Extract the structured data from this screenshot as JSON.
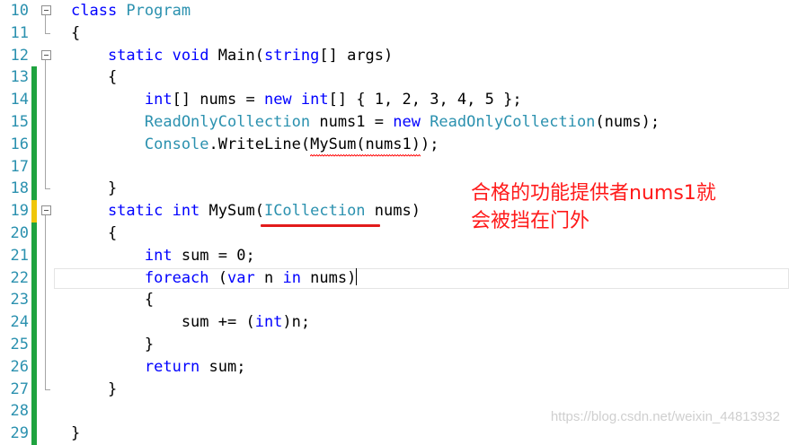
{
  "lines": [
    {
      "num": "10",
      "tokens": [
        {
          "t": "class ",
          "c": "kw"
        },
        {
          "t": "Program",
          "c": "ty"
        }
      ]
    },
    {
      "num": "11",
      "tokens": [
        {
          "t": "{",
          "c": ""
        }
      ]
    },
    {
      "num": "12",
      "tokens": [
        {
          "t": "    static void ",
          "c": "kw"
        },
        {
          "t": "Main(",
          "c": ""
        },
        {
          "t": "string",
          "c": "kw"
        },
        {
          "t": "[] args)",
          "c": ""
        }
      ]
    },
    {
      "num": "13",
      "tokens": [
        {
          "t": "    {",
          "c": ""
        }
      ]
    },
    {
      "num": "14",
      "tokens": [
        {
          "t": "        int",
          "c": "kw"
        },
        {
          "t": "[] nums = ",
          "c": ""
        },
        {
          "t": "new ",
          "c": "kw"
        },
        {
          "t": "int",
          "c": "kw"
        },
        {
          "t": "[] { 1, 2, 3, 4, 5 };",
          "c": ""
        }
      ]
    },
    {
      "num": "15",
      "tokens": [
        {
          "t": "        ReadOnlyCollection",
          "c": "ty"
        },
        {
          "t": " nums1 = ",
          "c": ""
        },
        {
          "t": "new ",
          "c": "kw"
        },
        {
          "t": "ReadOnlyCollection",
          "c": "ty"
        },
        {
          "t": "(nums);",
          "c": ""
        }
      ]
    },
    {
      "num": "16",
      "tokens": [
        {
          "t": "        Console",
          "c": "ty"
        },
        {
          "t": ".WriteLine(",
          "c": ""
        },
        {
          "t": "MySum(nums1)",
          "c": "sq"
        },
        {
          "t": ");",
          "c": ""
        }
      ]
    },
    {
      "num": "17",
      "tokens": []
    },
    {
      "num": "18",
      "tokens": [
        {
          "t": "    }",
          "c": ""
        }
      ]
    },
    {
      "num": "19",
      "tokens": [
        {
          "t": "    static int ",
          "c": "kw"
        },
        {
          "t": "MySum(",
          "c": ""
        },
        {
          "t": "ICollection",
          "c": "ty"
        },
        {
          "t": " nums)",
          "c": ""
        }
      ]
    },
    {
      "num": "20",
      "tokens": [
        {
          "t": "    {",
          "c": ""
        }
      ]
    },
    {
      "num": "21",
      "tokens": [
        {
          "t": "        int ",
          "c": "kw"
        },
        {
          "t": "sum = 0;",
          "c": ""
        }
      ]
    },
    {
      "num": "22",
      "tokens": [
        {
          "t": "        foreach ",
          "c": "kw"
        },
        {
          "t": "(",
          "c": ""
        },
        {
          "t": "var ",
          "c": "kw"
        },
        {
          "t": "n ",
          "c": ""
        },
        {
          "t": "in ",
          "c": "kw"
        },
        {
          "t": "nums)",
          "c": ""
        }
      ]
    },
    {
      "num": "23",
      "tokens": [
        {
          "t": "        {",
          "c": ""
        }
      ]
    },
    {
      "num": "24",
      "tokens": [
        {
          "t": "            sum += (",
          "c": ""
        },
        {
          "t": "int",
          "c": "kw"
        },
        {
          "t": ")n;",
          "c": ""
        }
      ]
    },
    {
      "num": "25",
      "tokens": [
        {
          "t": "        }",
          "c": ""
        }
      ]
    },
    {
      "num": "26",
      "tokens": [
        {
          "t": "        return ",
          "c": "kw"
        },
        {
          "t": "sum;",
          "c": ""
        }
      ]
    },
    {
      "num": "27",
      "tokens": [
        {
          "t": "    }",
          "c": ""
        }
      ]
    },
    {
      "num": "28",
      "tokens": []
    },
    {
      "num": "29",
      "tokens": [
        {
          "t": "}",
          "c": ""
        }
      ]
    }
  ],
  "changed_lines": [
    "13",
    "14",
    "15",
    "16",
    "17",
    "18",
    "20",
    "21",
    "22",
    "23",
    "24",
    "25",
    "26",
    "27",
    "28",
    "29"
  ],
  "unsaved_lines": [
    "19"
  ],
  "fold_lines": [
    "10",
    "12",
    "19"
  ],
  "current_line": "22",
  "annotation": {
    "line1": "合格的功能提供者nums1就",
    "line2": "会被挡在门外"
  },
  "watermark": "https://blog.csdn.net/weixin_44813932",
  "colors": {
    "keyword": "#0000ff",
    "type": "#2b91af",
    "line_number": "#2b91af",
    "annotation": "#ff1a1a",
    "changed_bar": "#1fa33f",
    "unsaved_bar": "#efc60a"
  }
}
